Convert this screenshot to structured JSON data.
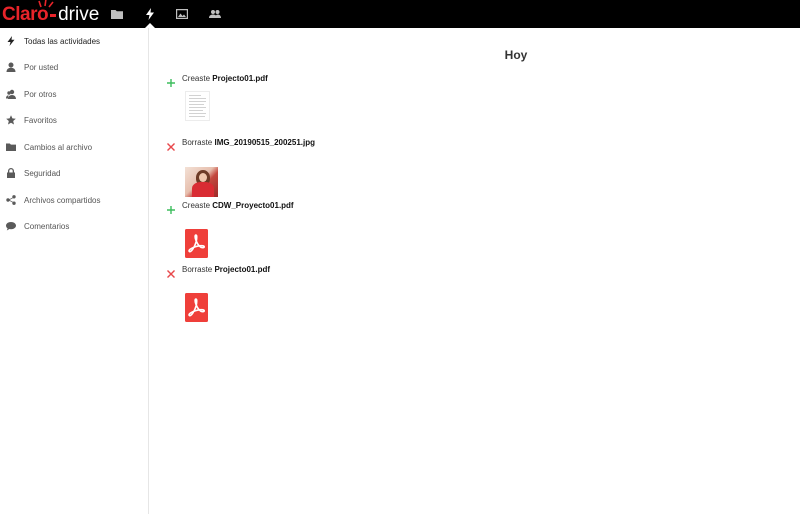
{
  "brand": {
    "claro": "Claro",
    "drive": "drive",
    "accent": "#e8242a"
  },
  "header": {
    "icons": [
      "folder-icon",
      "activity-icon",
      "image-icon",
      "contacts-icon"
    ],
    "active": "activity-icon"
  },
  "sidebar": {
    "items": [
      {
        "label": "Todas las actividades",
        "icon": "bolt-icon",
        "active": true
      },
      {
        "label": "Por usted",
        "icon": "user-icon"
      },
      {
        "label": "Por otros",
        "icon": "users-icon"
      },
      {
        "label": "Favoritos",
        "icon": "star-icon"
      },
      {
        "label": "Cambios al archivo",
        "icon": "folder-icon"
      },
      {
        "label": "Seguridad",
        "icon": "lock-icon"
      },
      {
        "label": "Archivos compartidos",
        "icon": "share-icon"
      },
      {
        "label": "Comentarios",
        "icon": "comment-icon"
      }
    ]
  },
  "main": {
    "day": "Hoy",
    "activities": [
      {
        "action": "Creaste",
        "file": "Projecto01.pdf",
        "type": "created",
        "thumb": "document"
      },
      {
        "action": "Borraste",
        "file": "IMG_20190515_200251.jpg",
        "type": "deleted",
        "thumb": "photo"
      },
      {
        "action": "Creaste",
        "file": "CDW_Proyecto01.pdf",
        "type": "created",
        "thumb": "pdf"
      },
      {
        "action": "Borraste",
        "file": "Projecto01.pdf",
        "type": "deleted",
        "thumb": "pdf"
      }
    ],
    "colors": {
      "created": "#3dbd5d",
      "deleted": "#e8484b",
      "pdf": "#ef3f3a"
    }
  }
}
